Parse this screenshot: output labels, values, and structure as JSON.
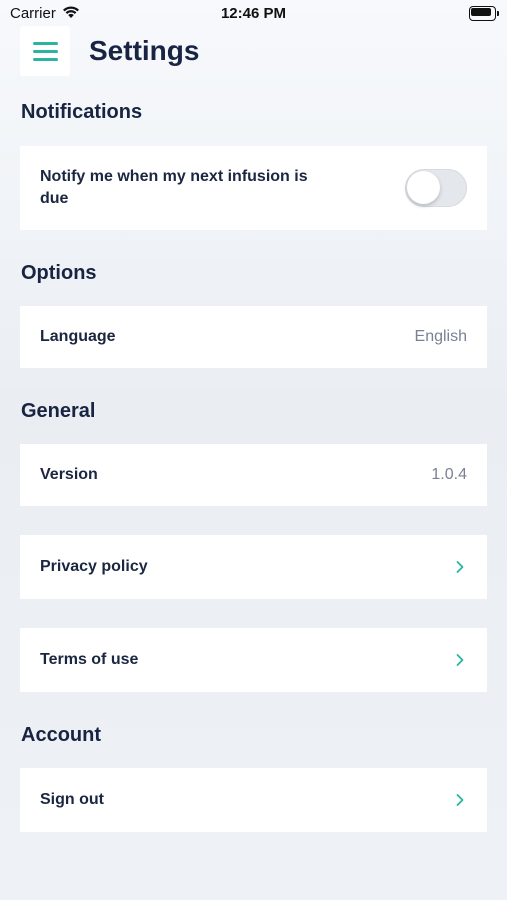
{
  "status_bar": {
    "carrier": "Carrier",
    "time": "12:46 PM"
  },
  "header": {
    "title": "Settings",
    "menu_icon": "hamburger-menu-icon"
  },
  "sections": {
    "notifications": {
      "title": "Notifications",
      "notify_label": "Notify me when my next infusion is due",
      "notify_enabled": false
    },
    "options": {
      "title": "Options",
      "language_label": "Language",
      "language_value": "English"
    },
    "general": {
      "title": "General",
      "version_label": "Version",
      "version_value": "1.0.4",
      "privacy_label": "Privacy policy",
      "terms_label": "Terms of use"
    },
    "account": {
      "title": "Account",
      "signout_label": "Sign out"
    }
  },
  "colors": {
    "accent": "#2bb5a0",
    "title": "#182442",
    "muted": "#7a8194"
  }
}
